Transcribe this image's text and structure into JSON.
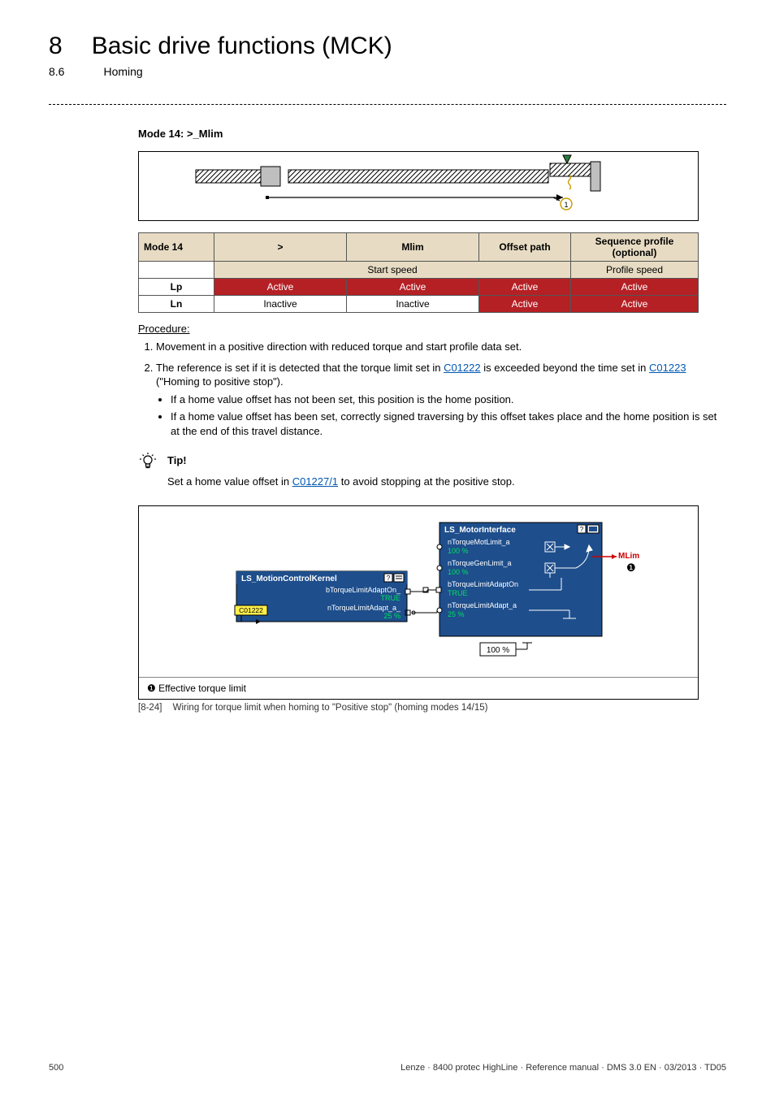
{
  "header": {
    "chapter_number": "8",
    "chapter_title": "Basic drive functions (MCK)",
    "section_number": "8.6",
    "section_title": "Homing"
  },
  "mode_heading": "Mode 14: >_Mlim",
  "table": {
    "head": {
      "c0": "Mode 14",
      "c1": ">",
      "c2": "Mlim",
      "c3": "Offset path",
      "c4": "Sequence profile (optional)"
    },
    "sub": {
      "left": "Start speed",
      "right": "Profile speed"
    },
    "rows": [
      {
        "label": "Lp",
        "cells": [
          "Active",
          "Active",
          "Active",
          "Active"
        ],
        "states": [
          "active",
          "active",
          "active",
          "active"
        ]
      },
      {
        "label": "Ln",
        "cells": [
          "Inactive",
          "Inactive",
          "Active",
          "Active"
        ],
        "states": [
          "inactive",
          "inactive",
          "active",
          "active"
        ]
      }
    ]
  },
  "procedure_label": "Procedure:",
  "procedure": {
    "item1": "Movement in a positive direction with reduced torque and start profile data set.",
    "item2_pre": "The reference is set if it is detected that the torque limit set in ",
    "item2_link1": "C01222",
    "item2_mid": " is exceeded beyond the time set in ",
    "item2_link2": "C01223",
    "item2_post": " (\"Homing to positive stop\").",
    "bullets": {
      "b1": "If a home value offset has not been set, this position is the home position.",
      "b2": "If a home value offset has been set, correctly signed traversing by this offset takes place and the home position is set at the end of this travel distance."
    }
  },
  "tip": {
    "label": "Tip!",
    "pre": "Set a home value offset in ",
    "link": "C01227/1",
    "post": " to avoid stopping at the positive stop."
  },
  "wiring": {
    "block1": {
      "title": "LS_MotionControlKernel",
      "row1": {
        "label": "bTorqueLimitAdaptOn_",
        "value": "TRUE"
      },
      "row2": {
        "label": "nTorqueLimitAdapt_a_",
        "value": "25 %",
        "src": "C01222"
      }
    },
    "block2": {
      "title": "LS_MotorInterface",
      "r1": {
        "label": "nTorqueMotLimit_a",
        "value": "100 %"
      },
      "r2": {
        "label": "nTorqueGenLimit_a",
        "value": "100 %"
      },
      "r3": {
        "label": "bTorqueLimitAdaptOn",
        "value": "TRUE"
      },
      "r4": {
        "label": "nTorqueLimitAdapt_a",
        "value": "25 %"
      }
    },
    "mlim": "MLim",
    "mlim_marker": "❶",
    "hundred": "100 %",
    "caption_marker": "❶",
    "caption_text": "Effective torque limit"
  },
  "figure_caption": {
    "bracket": "[8-24]",
    "text": "Wiring for torque limit when homing to \"Positive stop\" (homing modes 14/15)"
  },
  "footer": {
    "page": "500",
    "right": "Lenze · 8400 protec HighLine · Reference manual · DMS 3.0 EN · 03/2013 · TD05"
  }
}
